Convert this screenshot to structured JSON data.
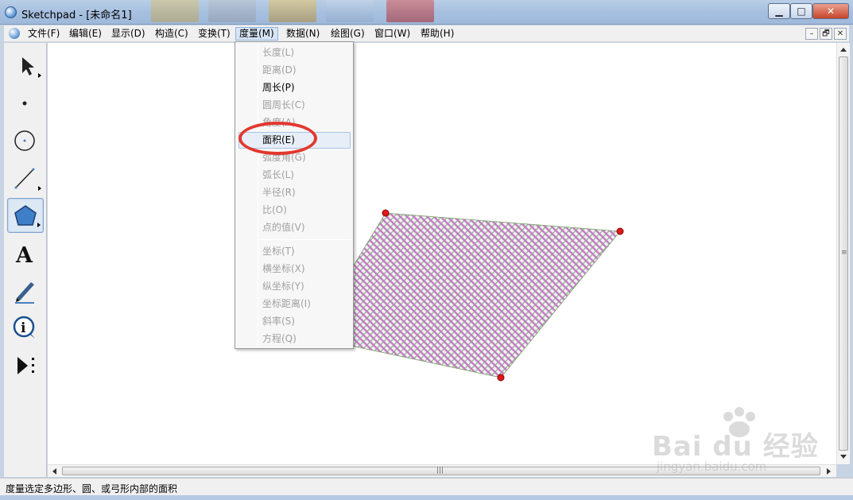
{
  "window": {
    "title": "Sketchpad  - [未命名1]",
    "buttons": {
      "minimize": "▁",
      "maximize": "□",
      "close": "✕"
    },
    "mdi_buttons": {
      "minimize": "–",
      "restore": "🗗",
      "close": "✕"
    }
  },
  "menubar": {
    "items": [
      {
        "label": "文件(F)"
      },
      {
        "label": "编辑(E)"
      },
      {
        "label": "显示(D)"
      },
      {
        "label": "构造(C)"
      },
      {
        "label": "变换(T)"
      },
      {
        "label": "度量(M)",
        "active": true
      },
      {
        "label": "数据(N)"
      },
      {
        "label": "绘图(G)"
      },
      {
        "label": "窗口(W)"
      },
      {
        "label": "帮助(H)"
      }
    ]
  },
  "toolbox": {
    "tools": [
      {
        "name": "selection-arrow-tool",
        "icon": "arrow-icon"
      },
      {
        "name": "point-tool",
        "icon": "point-icon"
      },
      {
        "name": "compass-tool",
        "icon": "circle-icon"
      },
      {
        "name": "straightedge-tool",
        "icon": "segment-icon"
      },
      {
        "name": "polygon-tool",
        "icon": "polygon-icon",
        "selected": true
      },
      {
        "name": "text-tool",
        "icon": "text-A-icon",
        "glyph": "A"
      },
      {
        "name": "marker-tool",
        "icon": "marker-pen-icon"
      },
      {
        "name": "information-tool",
        "icon": "info-icon",
        "glyph": "i"
      },
      {
        "name": "custom-tool",
        "icon": "custom-play-icon"
      }
    ]
  },
  "measure_menu": {
    "items": [
      {
        "label": "长度(L)",
        "enabled": false
      },
      {
        "label": "距离(D)",
        "enabled": false
      },
      {
        "label": "周长(P)",
        "enabled": true
      },
      {
        "label": "圆周长(C)",
        "enabled": false
      },
      {
        "label": "角度(A)",
        "enabled": false
      },
      {
        "label": "面积(E)",
        "enabled": true,
        "hovered": true
      },
      {
        "label": "弧度角(G)",
        "enabled": false
      },
      {
        "label": "弧长(L)",
        "enabled": false
      },
      {
        "label": "半径(R)",
        "enabled": false
      },
      {
        "label": "比(O)",
        "enabled": false
      },
      {
        "label": "点的值(V)",
        "enabled": false
      },
      {
        "label": "坐标(T)",
        "enabled": false,
        "group": 2
      },
      {
        "label": "横坐标(X)",
        "enabled": false,
        "group": 2
      },
      {
        "label": "纵坐标(Y)",
        "enabled": false,
        "group": 2
      },
      {
        "label": "坐标距离(I)",
        "enabled": false,
        "group": 2
      },
      {
        "label": "斜率(S)",
        "enabled": false,
        "group": 2
      },
      {
        "label": "方程(Q)",
        "enabled": false,
        "group": 2
      }
    ],
    "annotation_color": "#e2382e"
  },
  "canvas": {
    "polygon": {
      "fill_pattern": "crosshatch",
      "hatch_colors": [
        "#7fb07f",
        "#c47ac4"
      ],
      "vertex_color": "#e0191b"
    }
  },
  "statusbar": {
    "text": "度量选定多边形、圆、或弓形内部的面积"
  },
  "watermark": {
    "brand": "Bai du 经验",
    "url": "jingyan.baidu.com"
  }
}
